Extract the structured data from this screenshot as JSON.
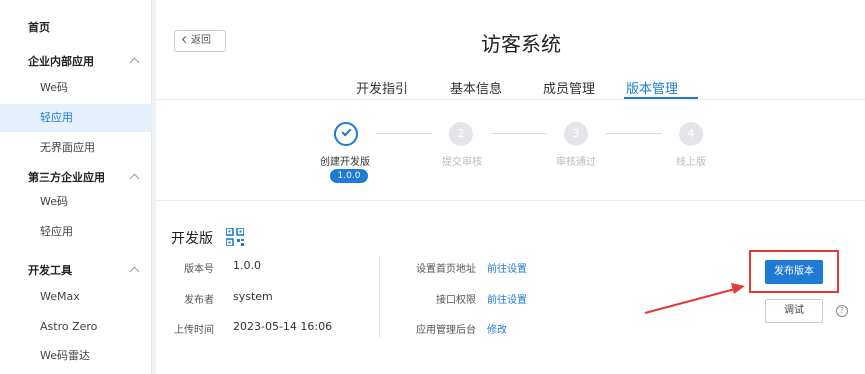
{
  "sidebar": {
    "home": "首页",
    "groups": [
      {
        "label": "企业内部应用",
        "items": [
          "We码",
          "轻应用",
          "无界面应用"
        ]
      },
      {
        "label": "第三方企业应用",
        "items": [
          "We码",
          "轻应用"
        ]
      },
      {
        "label": "开发工具",
        "items": [
          "WeMax",
          "Astro Zero",
          "We码雷达"
        ]
      }
    ],
    "active_item": "轻应用"
  },
  "header": {
    "back_label": "返回",
    "title": "访客系统"
  },
  "tabs": [
    "开发指引",
    "基本信息",
    "成员管理",
    "版本管理"
  ],
  "active_tab": "版本管理",
  "steps": [
    {
      "label": "创建开发版",
      "number": "",
      "status": "done"
    },
    {
      "label": "提交审核",
      "number": "2",
      "status": "todo"
    },
    {
      "label": "审核通过",
      "number": "3",
      "status": "todo"
    },
    {
      "label": "线上版",
      "number": "4",
      "status": "todo"
    }
  ],
  "version_badge": "1.0.0",
  "dev_version": {
    "title": "开发版",
    "fields": [
      {
        "label": "版本号",
        "value": "1.0.0"
      },
      {
        "label": "发布者",
        "value": "system"
      },
      {
        "label": "上传时间",
        "value": "2023-05-14 16:06"
      }
    ],
    "settings": [
      {
        "label": "设置首页地址",
        "link": "前往设置"
      },
      {
        "label": "接口权限",
        "link": "前往设置"
      },
      {
        "label": "应用管理后台",
        "link": "修改"
      }
    ]
  },
  "actions": {
    "publish_label": "发布版本",
    "debug_label": "调试",
    "help_symbol": "?"
  },
  "colors": {
    "accent": "#1f7ad6",
    "annotation": "#e53935"
  }
}
